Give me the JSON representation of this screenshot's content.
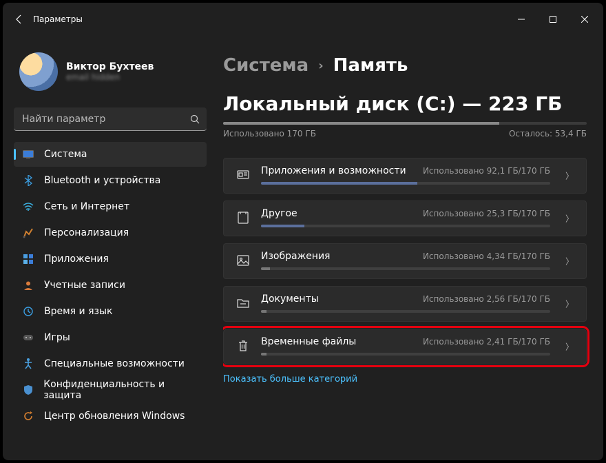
{
  "titlebar": {
    "title": "Параметры"
  },
  "user": {
    "name": "Виктор Бухтеев",
    "sub": "email hidden"
  },
  "search": {
    "placeholder": "Найти параметр"
  },
  "nav": {
    "items": [
      {
        "label": "Система",
        "active": true,
        "icon": "system"
      },
      {
        "label": "Bluetooth и устройства",
        "icon": "bluetooth"
      },
      {
        "label": "Сеть и Интернет",
        "icon": "network"
      },
      {
        "label": "Персонализация",
        "icon": "personalization"
      },
      {
        "label": "Приложения",
        "icon": "apps"
      },
      {
        "label": "Учетные записи",
        "icon": "accounts"
      },
      {
        "label": "Время и язык",
        "icon": "time"
      },
      {
        "label": "Игры",
        "icon": "gaming"
      },
      {
        "label": "Специальные возможности",
        "icon": "accessibility"
      },
      {
        "label": "Конфиденциальность и защита",
        "icon": "privacy"
      },
      {
        "label": "Центр обновления Windows",
        "icon": "update"
      }
    ]
  },
  "breadcrumb": {
    "parent": "Система",
    "current": "Память"
  },
  "disk": {
    "title": "Локальный диск (C:) — 223 ГБ",
    "used_label": "Использовано 170 ГБ",
    "free_label": "Осталось: 53,4 ГБ",
    "fill_pct": 76
  },
  "categories": [
    {
      "name": "Приложения и возможности",
      "usage": "Использовано 92,1 ГБ/170 ГБ",
      "pct": 54,
      "color": "#5b6f9c",
      "icon": "apps-features"
    },
    {
      "name": "Другое",
      "usage": "Использовано 25,3 ГБ/170 ГБ",
      "pct": 15,
      "color": "#5b6f9c",
      "icon": "other"
    },
    {
      "name": "Изображения",
      "usage": "Использовано 4,34 ГБ/170 ГБ",
      "pct": 3,
      "color": "#767676",
      "icon": "images"
    },
    {
      "name": "Документы",
      "usage": "Использовано 2,56 ГБ/170 ГБ",
      "pct": 2,
      "color": "#767676",
      "icon": "documents"
    },
    {
      "name": "Временные файлы",
      "usage": "Использовано 2,41 ГБ/170 ГБ",
      "pct": 2,
      "color": "#767676",
      "icon": "temp",
      "highlight": true
    }
  ],
  "more_link": "Показать больше категорий"
}
